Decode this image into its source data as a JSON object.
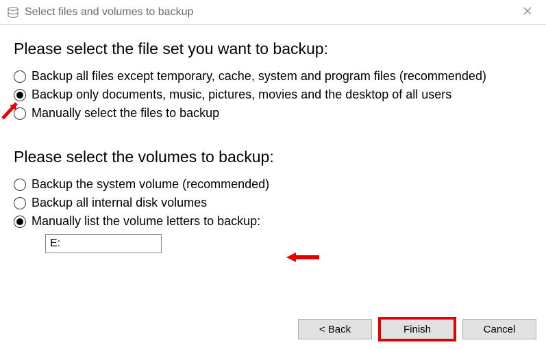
{
  "window": {
    "title": "Select files and volumes to backup"
  },
  "fileset": {
    "heading": "Please select the file set you want to backup:",
    "options": [
      {
        "label": "Backup all files except temporary, cache, system and program files (recommended)",
        "selected": false
      },
      {
        "label": "Backup only documents, music, pictures, movies and the desktop of all users",
        "selected": true
      },
      {
        "label": "Manually select the files to backup",
        "selected": false
      }
    ]
  },
  "volumes": {
    "heading": "Please select the volumes to backup:",
    "options": [
      {
        "label": "Backup the system volume (recommended)",
        "selected": false
      },
      {
        "label": "Backup all internal disk volumes",
        "selected": false
      },
      {
        "label": "Manually list the volume letters to backup:",
        "selected": true
      }
    ],
    "manual_value": "E:"
  },
  "buttons": {
    "back": "< Back",
    "finish": "Finish",
    "cancel": "Cancel"
  }
}
